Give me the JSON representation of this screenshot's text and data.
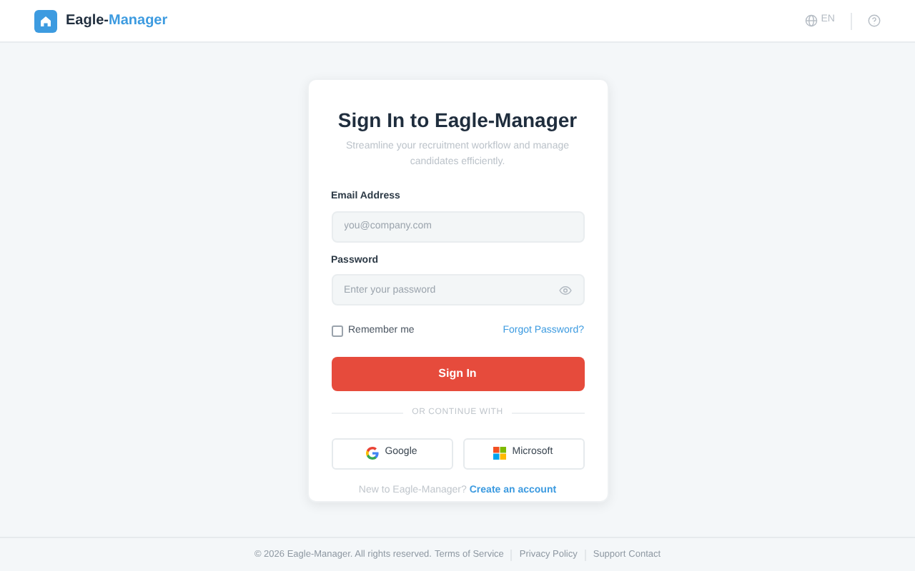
{
  "header": {
    "brand": {
      "prefix": "Eagle-",
      "suffix": "Manager"
    },
    "language": "EN"
  },
  "card": {
    "title": "Sign In to Eagle-Manager",
    "subtitle": "Streamline your recruitment workflow and manage candidates efficiently.",
    "fields": [
      {
        "label": "Email Address",
        "placeholder": "you@company.com",
        "kind": "email"
      },
      {
        "label": "Password",
        "placeholder": "Enter your password",
        "kind": "password"
      }
    ],
    "remember": {
      "label": "Remember me",
      "checked": false
    },
    "forgot": "Forgot Password?",
    "submit": "Sign In",
    "divider": "OR CONTINUE WITH",
    "providers": [
      {
        "label": "Google",
        "kind": "google"
      },
      {
        "label": "Microsoft",
        "kind": "microsoft"
      }
    ],
    "signup": {
      "prompt": "New to Eagle-Manager?",
      "link": "Create an account"
    }
  },
  "footer": {
    "copyright": "© 2026 Eagle-Manager. All rights reserved.",
    "link_groups": [
      [
        "Terms of Service"
      ],
      [
        "Privacy Policy"
      ],
      [
        "Support",
        "Contact"
      ]
    ]
  }
}
